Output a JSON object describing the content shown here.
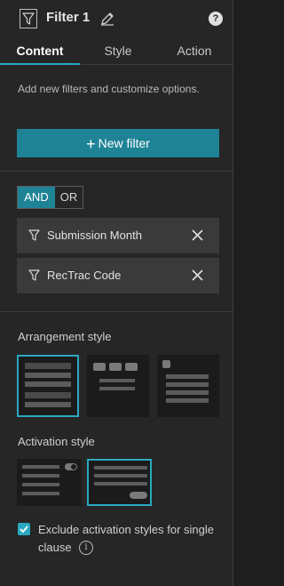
{
  "header": {
    "title": "Filter 1",
    "help_label": "?"
  },
  "tabs": [
    {
      "label": "Content",
      "active": true
    },
    {
      "label": "Style",
      "active": false
    },
    {
      "label": "Action",
      "active": false
    }
  ],
  "content": {
    "hint": "Add new filters and customize options.",
    "new_filter_label": "New filter",
    "logic": {
      "and_label": "AND",
      "or_label": "OR",
      "selected": "AND"
    },
    "clauses": [
      {
        "label": "Submission Month"
      },
      {
        "label": "RecTrac Code"
      }
    ],
    "arrangement_label": "Arrangement style",
    "arrangement_selected": 0,
    "activation_label": "Activation style",
    "activation_selected": 1,
    "exclude_label": "Exclude activation styles for single clause",
    "exclude_checked": true,
    "info_label": "i"
  },
  "colors": {
    "accent": "#1f8396",
    "accent_border": "#2aa9c0",
    "panel_bg": "#262626",
    "clause_bg": "#3a3a3a"
  },
  "icons": [
    "filter-icon",
    "pencil-icon",
    "help-icon",
    "plus-icon",
    "close-icon",
    "check-icon",
    "info-icon",
    "toggle-icon"
  ]
}
